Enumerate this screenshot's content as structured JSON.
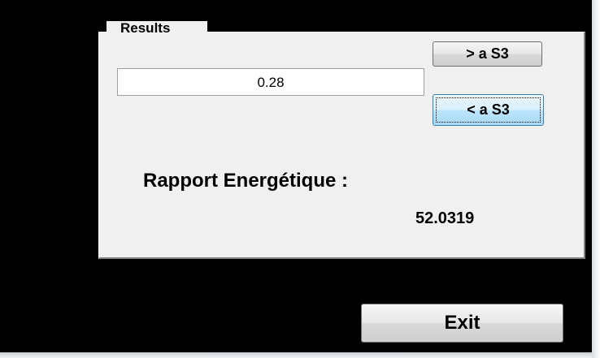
{
  "results_panel": {
    "title": "Results",
    "value_field": "0.28",
    "greater_button_label": "> a S3",
    "less_button_label": "< a S3",
    "ratio_label": "Rapport Energétique :",
    "ratio_value": "52.0319"
  },
  "footer": {
    "exit_label": "Exit"
  }
}
